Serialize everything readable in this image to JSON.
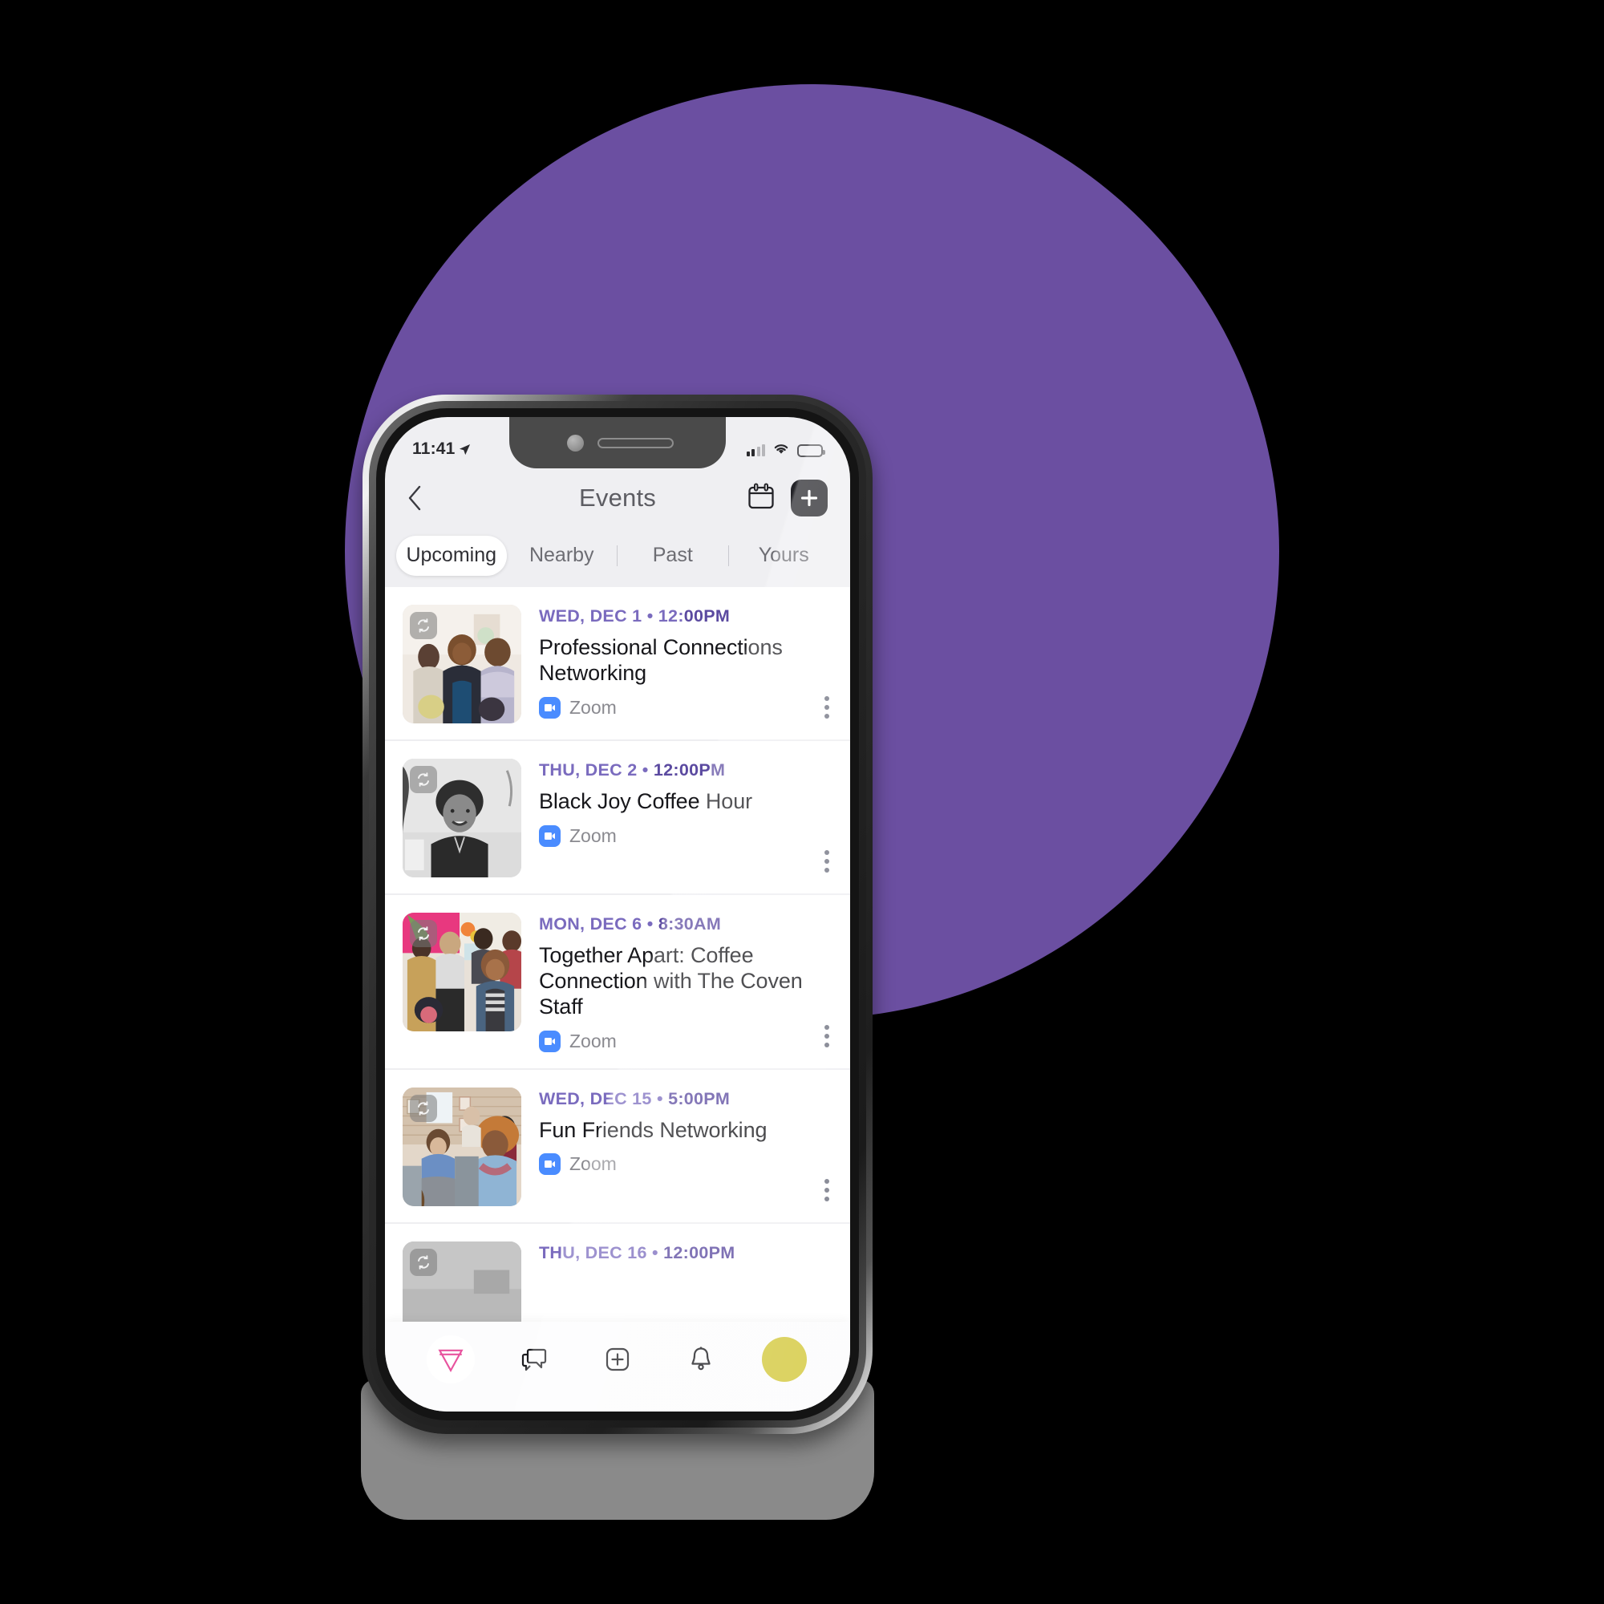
{
  "theme": {
    "backdrop_purple": "#6B4FA1",
    "accent_date_purple": "#7A6BBE",
    "zoom_blue": "#4A8CFF",
    "avatar_yellow": "#D4C93F",
    "logo_pink": "#E8539E",
    "plus_button_dark": "#232328"
  },
  "status_bar": {
    "time": "11:41",
    "location_icon": "location-arrow-icon",
    "signal_icon": "cellular-signal-icon",
    "wifi_icon": "wifi-icon",
    "battery_icon": "battery-icon"
  },
  "header": {
    "back_icon": "chevron-left-icon",
    "title": "Events",
    "calendar_icon": "calendar-icon",
    "add_icon": "plus-icon"
  },
  "tabs": [
    {
      "label": "Upcoming",
      "active": true
    },
    {
      "label": "Nearby",
      "active": false
    },
    {
      "label": "Past",
      "active": false
    },
    {
      "label": "Yours",
      "active": false
    }
  ],
  "events": [
    {
      "date": "WED, DEC 1 • 12:",
      "date_tail": "00PM",
      "title": "Professional Connections Networking",
      "location": "Zoom",
      "location_icon": "zoom-icon",
      "recurring_icon": "repeat-icon",
      "menu_icon": "kebab-menu-icon",
      "thumb_alt": "three-women-talking-at-networking-event"
    },
    {
      "date": "THU, DEC 2 • ",
      "date_tail": "12:00PM",
      "title": "Black Joy Coffee Hour",
      "location": "Zoom",
      "location_icon": "zoom-icon",
      "recurring_icon": "repeat-icon",
      "menu_icon": "kebab-menu-icon",
      "thumb_alt": "smiling-person-portrait-black-and-white"
    },
    {
      "date": "MON, DEC 6 • ",
      "date_tail": "8:30AM",
      "title": "Together Apart: Coffee Connection with The Coven Staff",
      "location": "Zoom",
      "location_icon": "zoom-icon",
      "recurring_icon": "repeat-icon",
      "menu_icon": "kebab-menu-icon",
      "thumb_alt": "women-mingling-at-coffee-event"
    },
    {
      "date": "WED, DEC 15 • ",
      "date_tail": "5:00PM",
      "title": "Fun Friends Networking",
      "location": "Zoom",
      "location_icon": "zoom-icon",
      "recurring_icon": "repeat-icon",
      "menu_icon": "kebab-menu-icon",
      "thumb_alt": "two-women-seated-on-couch-chatting"
    },
    {
      "date": "THU, DEC 16 • ",
      "date_tail": "12:00PM",
      "title": "",
      "location": "",
      "location_icon": "zoom-icon",
      "recurring_icon": "repeat-icon",
      "menu_icon": "kebab-menu-icon",
      "thumb_alt": "partially-visible-event-thumbnail"
    }
  ],
  "bottom_nav": [
    {
      "name": "home-logo",
      "icon": "coven-triangle-logo-icon"
    },
    {
      "name": "messages",
      "icon": "chat-bubbles-icon"
    },
    {
      "name": "create",
      "icon": "plus-square-icon"
    },
    {
      "name": "notifications",
      "icon": "bell-icon"
    },
    {
      "name": "profile",
      "icon": "avatar-circle-icon"
    }
  ]
}
